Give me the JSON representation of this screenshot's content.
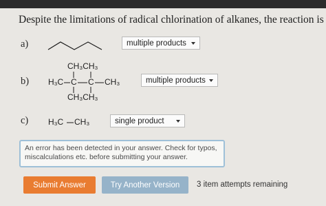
{
  "question_text": "Despite the limitations of radical chlorination of alkanes, the reaction is still useful",
  "parts": [
    {
      "label": "a)",
      "selected": "multiple products"
    },
    {
      "label": "b)",
      "selected": "multiple products"
    },
    {
      "label": "c)",
      "selected": "single product"
    }
  ],
  "molecule_b": {
    "top": "CH₃CH₃",
    "left": "H₃C",
    "center1": "C",
    "center2": "C",
    "right": "CH₃",
    "bottom": "CH₃CH₃"
  },
  "molecule_c": {
    "left": "H₃C",
    "right": "CH₃"
  },
  "error_message": "An error has been detected in your answer. Check for typos, miscalculations etc. before submitting your answer.",
  "buttons": {
    "submit": "Submit Answer",
    "try_another": "Try Another Version"
  },
  "attempts_text": "3 item attempts remaining",
  "colors": {
    "submit": "#e97c31",
    "try_another": "#96b3c9",
    "error_border": "#9ec0d8",
    "top_bar": "#2c2c2c"
  }
}
